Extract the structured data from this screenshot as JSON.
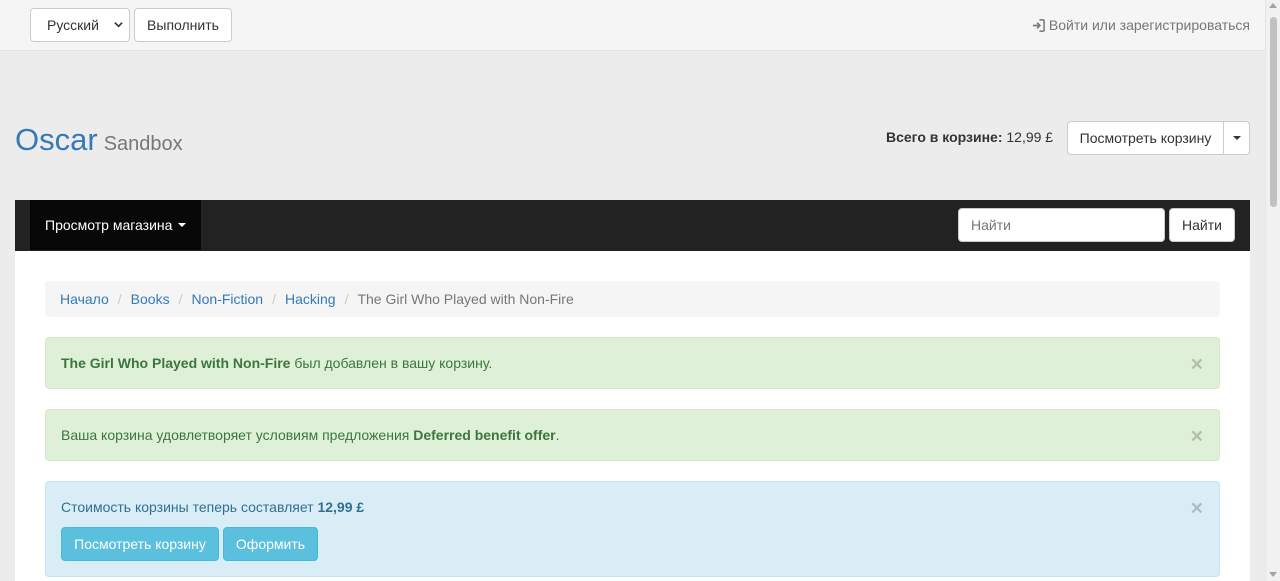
{
  "topbar": {
    "language_selected": "Русский",
    "go_label": "Выполнить",
    "login_label": "Войти или зарегистрироваться"
  },
  "brand": {
    "name": "Oscar",
    "subtitle": "Sandbox"
  },
  "basket": {
    "total_label": "Всего в корзине:",
    "total_value": "12,99 £",
    "view_label": "Посмотреть корзину"
  },
  "navbar": {
    "browse_label": "Просмотр магазина",
    "search_placeholder": "Найти",
    "search_button": "Найти"
  },
  "breadcrumb": {
    "items": [
      "Начало",
      "Books",
      "Non-Fiction",
      "Hacking"
    ],
    "active": "The Girl Who Played with Non-Fire"
  },
  "alerts": {
    "added": {
      "product": "The Girl Who Played with Non-Fire",
      "text": " был добавлен в вашу корзину."
    },
    "offer": {
      "text_before": "Ваша корзина удовлетворяет условиям предложения ",
      "offer_name": "Deferred benefit offer",
      "text_after": "."
    },
    "total": {
      "text": "Стоимость корзины теперь составляет ",
      "amount": "12,99 £",
      "view_basket": "Посмотреть корзину",
      "checkout": "Оформить"
    },
    "close_symbol": "×"
  }
}
